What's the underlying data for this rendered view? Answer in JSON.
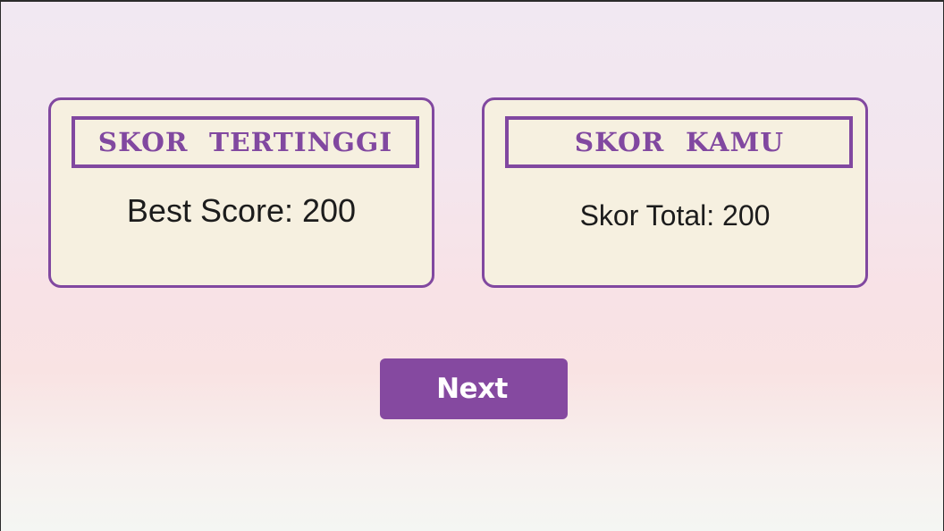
{
  "best_score_card": {
    "title": "SKOR TERTINGGI",
    "text": "Best Score: 200"
  },
  "your_score_card": {
    "title": "SKOR KAMU",
    "text": "Skor Total: 200"
  },
  "next_button": {
    "label": "Next"
  },
  "colors": {
    "accent": "#8148a0",
    "card_background": "#f6f0e0",
    "button_background": "#8549a0",
    "button_text": "#ffffff",
    "body_text": "#1c1c1c"
  }
}
